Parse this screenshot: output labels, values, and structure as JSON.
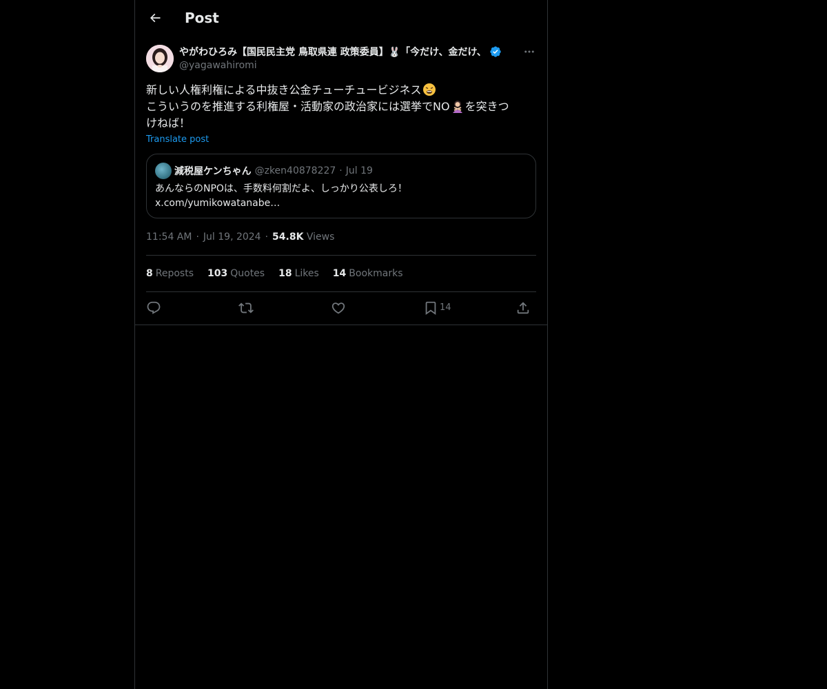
{
  "header": {
    "title": "Post",
    "back_icon": "arrow-left-icon"
  },
  "post": {
    "author": {
      "display_name": "やがわひろみ【国民民主党 鳥取県連 政策委員】🐰「今だけ、金だけ、",
      "handle": "@yagawahiromi",
      "verified": true,
      "verified_color": "#1d9bf0"
    },
    "text_lines": [
      "新しい人権利権による中抜き公金チューチュービジネス",
      "こういうのを推進する利権屋・活動家の政治家には選挙でNO",
      "を突きつ",
      "けねば！"
    ],
    "emoji_1": "weary-face-icon",
    "emoji_2": "person-gesturing-no-icon",
    "translate_label": "Translate post",
    "quote": {
      "display_name": "減税屋ケンちゃん",
      "handle": "@zken40878227",
      "date": "Jul 19",
      "text_line1": "あんならのNPOは、手数料何割だよ、しっかり公表しろ！",
      "text_line2": "x.com/yumikowatanabe…"
    },
    "time": "11:54 AM",
    "date": "Jul 19, 2024",
    "views_count": "54.8K",
    "views_label": "Views"
  },
  "stats": {
    "reposts_count": "8",
    "reposts_label": "Reposts",
    "quotes_count": "103",
    "quotes_label": "Quotes",
    "likes_count": "18",
    "likes_label": "Likes",
    "bookmarks_count": "14",
    "bookmarks_label": "Bookmarks"
  },
  "actions": {
    "reply_icon": "reply-icon",
    "repost_icon": "repost-icon",
    "like_icon": "heart-icon",
    "bookmark_icon": "bookmark-icon",
    "bookmark_count": "14",
    "share_icon": "share-icon"
  },
  "colors": {
    "background": "#000000",
    "text": "#e7e9ea",
    "secondary_text": "#71767b",
    "border": "#2f3336",
    "link": "#1d9bf0"
  }
}
